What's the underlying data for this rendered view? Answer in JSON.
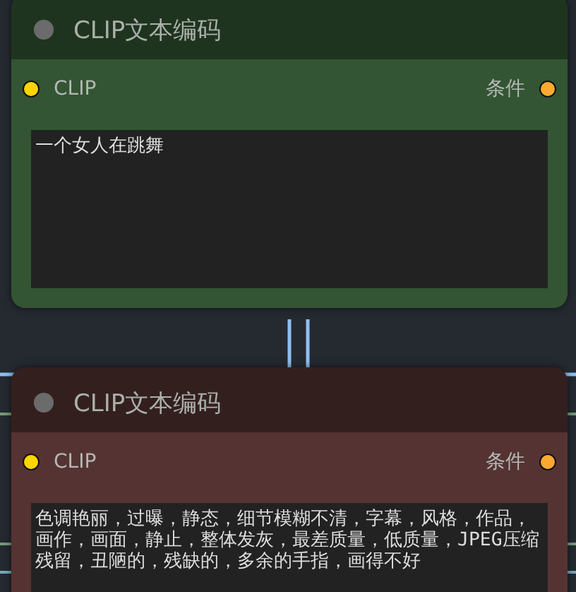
{
  "nodes": [
    {
      "title": "CLIP文本编码",
      "color": "#335533",
      "input": {
        "label": "CLIP",
        "color": "#ffd500"
      },
      "output": {
        "label": "条件",
        "color": "#ffa931"
      },
      "text": "一个女人在跳舞"
    },
    {
      "title": "CLIP文本编码",
      "color": "#553333",
      "input": {
        "label": "CLIP",
        "color": "#ffd500"
      },
      "output": {
        "label": "条件",
        "color": "#ffa931"
      },
      "text": "色调艳丽，过曝，静态，细节模糊不清，字幕，风格，作品，画作，画面，静止，整体发灰，最差质量，低质量，JPEG压缩残留，丑陋的，残缺的，多余的手指，画得不好"
    }
  ]
}
